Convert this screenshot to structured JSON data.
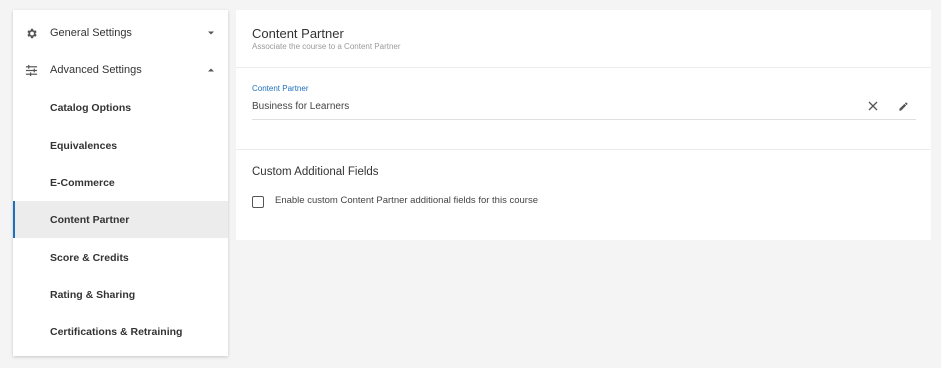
{
  "sidebar": {
    "groups": [
      {
        "label": "General Settings",
        "icon": "gear-icon",
        "chevron": "chevron-down-icon"
      },
      {
        "label": "Advanced Settings",
        "icon": "sliders-icon",
        "chevron": "chevron-up-icon"
      }
    ],
    "items": [
      {
        "label": "Catalog Options"
      },
      {
        "label": "Equivalences"
      },
      {
        "label": "E-Commerce"
      },
      {
        "label": "Content Partner",
        "active": true
      },
      {
        "label": "Score & Credits"
      },
      {
        "label": "Rating & Sharing"
      },
      {
        "label": "Certifications & Retraining"
      }
    ]
  },
  "main": {
    "title": "Content Partner",
    "subtitle": "Associate the course to a Content Partner",
    "field": {
      "label": "Content Partner",
      "value": "Business for Learners"
    },
    "custom_section": {
      "title": "Custom Additional Fields",
      "checkbox_label": "Enable custom Content Partner additional fields for this course",
      "checked": false
    }
  },
  "colors": {
    "accent": "#1f6fbf",
    "background": "#f4f4f4",
    "active_item_bg": "#ececec"
  }
}
